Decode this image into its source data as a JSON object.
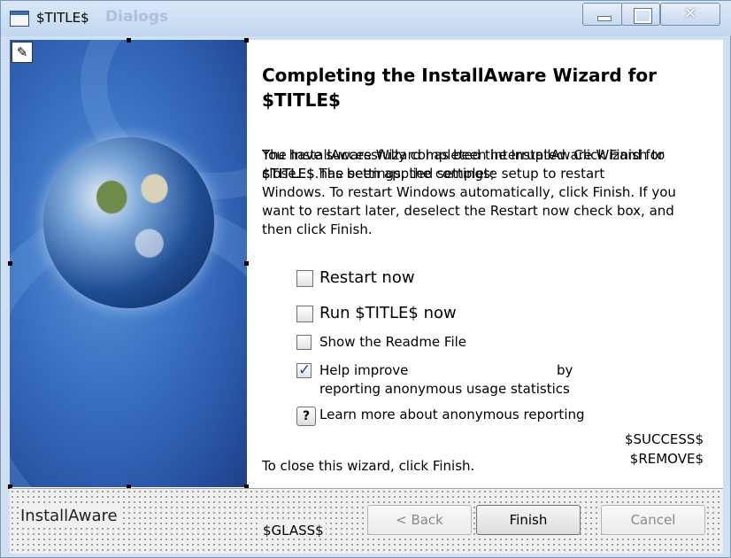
{
  "window": {
    "title": "$TITLE$",
    "ghost_title": "Dialogs"
  },
  "heading": "Completing the InstallAware Wizard for $TITLE$",
  "body": {
    "overlap_line1_a": "You have successfully completed the InstallAware Wizard for $TITLE$.",
    "overlap_line1_b": "The InstallAware Wizard has been interrupted. Click Finish to close.",
    "overlap_line2_a": "$TITLE$ has been applied settings;",
    "overlap_line2_b": "$TITLE$ The settings, the complete setup to restart",
    "rest": "Windows. To restart Windows automatically, click Finish. If you want to restart later, deselect the Restart now check box, and then click Finish."
  },
  "options": {
    "restart_now": "Restart now",
    "run_now": "Run $TITLE$ now",
    "readme": "Show the Readme File",
    "help_improve_line1": "Help improve",
    "help_improve_by": "by",
    "help_improve_line2": "reporting anonymous usage statistics",
    "learn_more": "Learn more about anonymous reporting",
    "help_button": "?"
  },
  "tokens": {
    "success": "$SUCCESS$",
    "remove": "$REMOVE$"
  },
  "close_text": "To close this wizard, click Finish.",
  "footer": {
    "brand": "InstallAware",
    "glass": "$GLASS$",
    "back": "< Back",
    "finish": "Finish",
    "cancel": "Cancel"
  }
}
